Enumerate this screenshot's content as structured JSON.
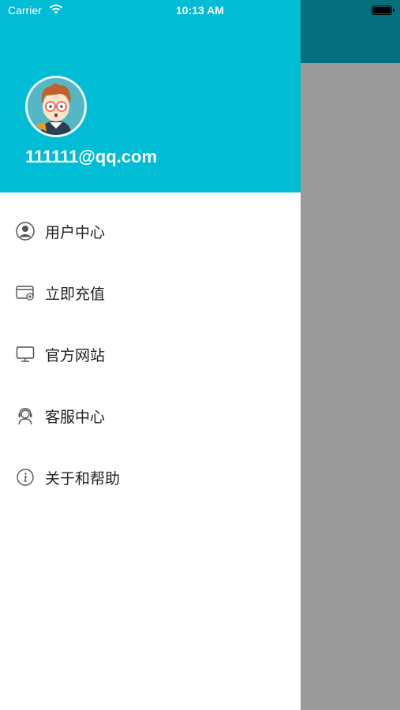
{
  "status_bar": {
    "carrier": "Carrier",
    "time": "10:13 AM"
  },
  "header": {
    "email": "111111@qq.com",
    "background_color": "#00bcd4"
  },
  "menu": {
    "items": [
      {
        "label": "用户中心",
        "icon": "user-circle-icon"
      },
      {
        "label": "立即充值",
        "icon": "recharge-card-icon"
      },
      {
        "label": "官方网站",
        "icon": "monitor-icon"
      },
      {
        "label": "客服中心",
        "icon": "customer-service-icon"
      },
      {
        "label": "关于和帮助",
        "icon": "info-icon"
      }
    ]
  }
}
